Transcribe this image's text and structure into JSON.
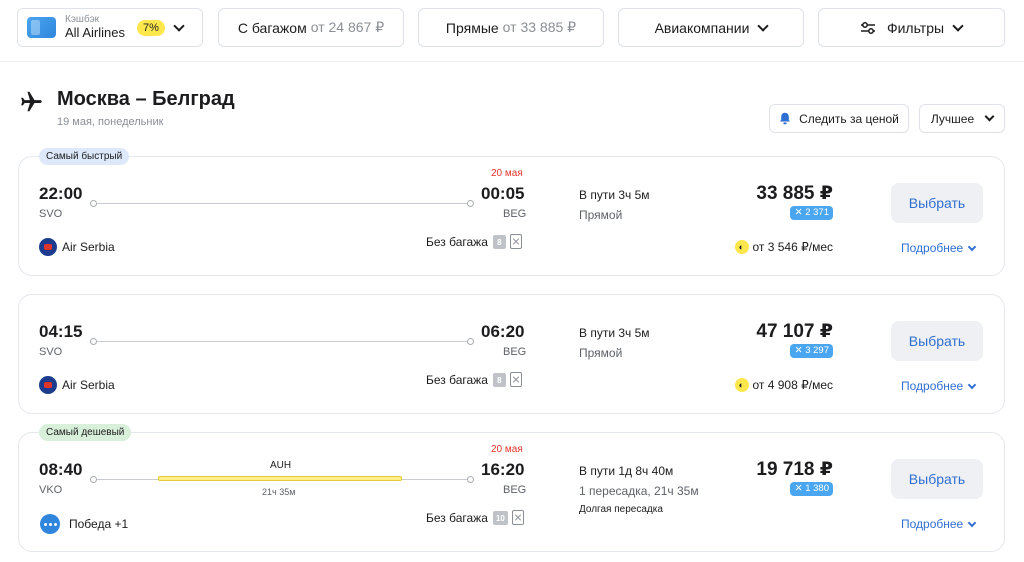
{
  "topbar": {
    "cashback_small": "Кэшбэк",
    "cashback_main": "All Airlines",
    "cashback_badge": "7%",
    "baggage_label": "С багажом",
    "baggage_price": "от 24 867 ₽",
    "direct_label": "Прямые",
    "direct_price": "от 33 885 ₽",
    "airlines_label": "Авиакомпании",
    "filters_label": "Фильтры"
  },
  "header": {
    "title": "Москва – Белград",
    "subtitle": "19 мая, понедельник",
    "watch_label": "Следить за ценой",
    "sort_label": "Лучшее"
  },
  "tickets": [
    {
      "tag": "Самый быстрый",
      "dep_time": "22:00",
      "dep_code": "SVO",
      "arr_time": "00:05",
      "arr_code": "BEG",
      "arr_date_note": "20 мая",
      "airline": "Air Serbia",
      "baggage": "Без багажа",
      "bag_weight": "8",
      "duration": "В пути 3ч 5м",
      "stops": "Прямой",
      "price": "33 885 ₽",
      "miles": "✕ 2 371",
      "installment": "от 3 546 ₽/мес",
      "select_label": "Выбрать",
      "more_label": "Подробнее"
    },
    {
      "dep_time": "04:15",
      "dep_code": "SVO",
      "arr_time": "06:20",
      "arr_code": "BEG",
      "airline": "Air Serbia",
      "baggage": "Без багажа",
      "bag_weight": "8",
      "duration": "В пути 3ч 5м",
      "stops": "Прямой",
      "price": "47 107 ₽",
      "miles": "✕ 3 297",
      "installment": "от 4 908 ₽/мес",
      "select_label": "Выбрать",
      "more_label": "Подробнее"
    },
    {
      "tag": "Самый дешевый",
      "dep_time": "08:40",
      "dep_code": "VKO",
      "arr_time": "16:20",
      "arr_code": "BEG",
      "arr_date_note": "20 мая",
      "transfer_code": "AUH",
      "transfer_duration": "21ч 35м",
      "airline": "Победа +1",
      "baggage": "Без багажа",
      "bag_weight": "10",
      "duration": "В пути 1д 8ч 40м",
      "stops": "1 пересадка, 21ч 35м",
      "long_stop": "Долгая пересадка",
      "price": "19 718 ₽",
      "miles": "✕ 1 380",
      "select_label": "Выбрать",
      "more_label": "Подробнее"
    }
  ]
}
